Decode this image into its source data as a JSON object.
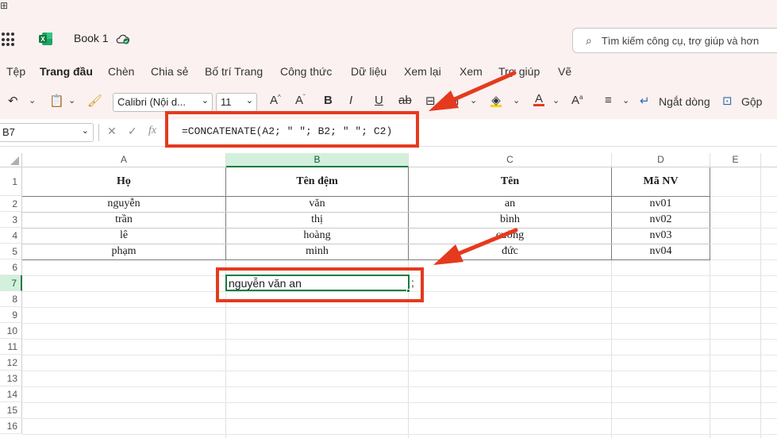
{
  "app": {
    "book_title": "Book 1",
    "search_placeholder": "Tìm kiếm công cụ, trợ giúp và hơn"
  },
  "menu": [
    "Tệp",
    "Trang đầu",
    "Chèn",
    "Chia sẻ",
    "Bố trí Trang",
    "Công thức",
    "Dữ liệu",
    "Xem lại",
    "Xem",
    "Trợ giúp",
    "Vẽ"
  ],
  "toolbar": {
    "font_name": "Calibri (Nội d...",
    "font_size": "11",
    "wrap_label": "Ngắt dòng",
    "merge_label": "Gộp"
  },
  "formula_bar": {
    "name_box": "B7",
    "fx": "fx",
    "formula": "=CONCATENATE(A2; \" \"; B2; \" \"; C2)"
  },
  "columns": [
    "A",
    "B",
    "C",
    "D",
    "E"
  ],
  "rows": [
    "1",
    "2",
    "3",
    "4",
    "5",
    "6",
    "7",
    "8",
    "9",
    "10",
    "11",
    "12",
    "13",
    "14",
    "15",
    "16"
  ],
  "table": {
    "headers": [
      "Họ",
      "Tên đệm",
      "Tên",
      "Mã NV"
    ],
    "rows": [
      [
        "nguyễn",
        "văn",
        "an",
        "nv01"
      ],
      [
        "trần",
        "thị",
        "bình",
        "nv02"
      ],
      [
        "lê",
        "hoàng",
        "cường",
        "nv03"
      ],
      [
        "phạm",
        "minh",
        "đức",
        "nv04"
      ]
    ]
  },
  "active_cell": {
    "value": "nguyễn văn an",
    "overflow": ";"
  },
  "colors": {
    "accent_green": "#107c41",
    "annotation_red": "#e53a1e",
    "ribbon_bg": "#fbf1f0"
  }
}
